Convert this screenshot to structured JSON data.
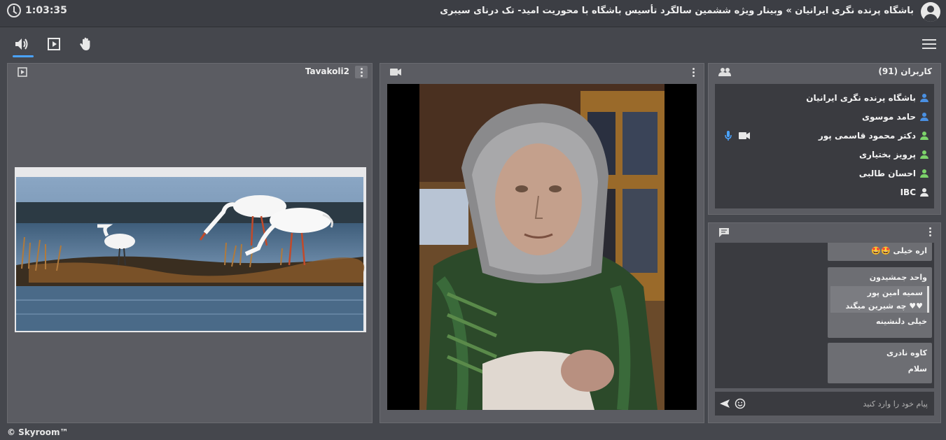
{
  "header": {
    "timer": "1:03:35",
    "room_title": "باشگاه پرنده نگری ایرانیان » وبینار ویژه ششمین سالگرد تأسیس باشگاه با محوریت امید- تک درنای سیبری"
  },
  "toolbar": {
    "icons": [
      "speaker-icon",
      "play-box-icon",
      "hand-icon",
      "menu-icon"
    ]
  },
  "presentation": {
    "title": "Tavakoli2"
  },
  "users": {
    "title": "کاربران (91)",
    "list": [
      {
        "name": "باشگاه پرنده نگری ایرانیان",
        "status_color": "#4a90e2"
      },
      {
        "name": "حامد موسوی",
        "status_color": "#4a90e2"
      },
      {
        "name": "دکتر محمود قاسمی پور",
        "status_color": "#7cd36a",
        "mic": true,
        "camera": true
      },
      {
        "name": "پرویز بختیاری",
        "status_color": "#7cd36a"
      },
      {
        "name": "احسان طالبی",
        "status_color": "#7cd36a"
      },
      {
        "name": "IBC",
        "status_color": "#e8e8e8"
      }
    ]
  },
  "chat": {
    "messages": [
      {
        "text": "اره خیلی 🤩🤩"
      },
      {
        "sender": "واحد جمشیدون",
        "quote_author": "سمیه امین پور",
        "quote_text": "♥♥ چه شیرین میگند",
        "text": "خیلی دلنشینه"
      },
      {
        "sender": "کاوه نادری",
        "text": "سلام"
      }
    ],
    "input_placeholder": "پیام خود را وارد کنید"
  },
  "footer": {
    "brand": "© Skyroom™"
  }
}
